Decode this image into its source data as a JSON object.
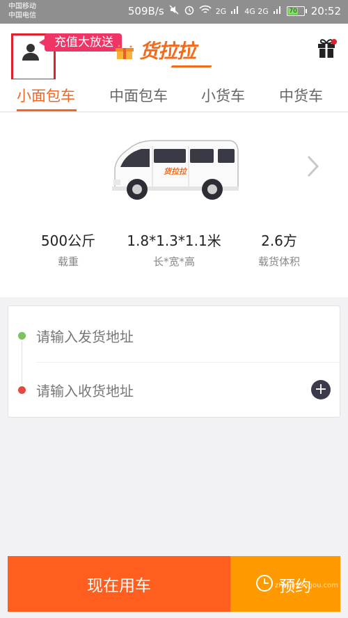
{
  "status_bar": {
    "carrier1": "中国移动",
    "carrier2": "中国电信",
    "net_speed": "509B/s",
    "net1": "2G",
    "net2": "4G 2G",
    "battery": "70",
    "time": "20:52"
  },
  "header": {
    "promo_label": "充值大放送",
    "logo_text": "货拉拉"
  },
  "tabs": [
    {
      "label": "小面包车",
      "active": true
    },
    {
      "label": "中面包车",
      "active": false
    },
    {
      "label": "小货车",
      "active": false
    },
    {
      "label": "中货车",
      "active": false
    }
  ],
  "vehicle": {
    "brand_on_van": "货拉拉",
    "specs": [
      {
        "value": "500公斤",
        "label": "载重"
      },
      {
        "value": "1.8*1.3*1.1米",
        "label": "长*宽*高"
      },
      {
        "value": "2.6方",
        "label": "载货体积"
      }
    ]
  },
  "address": {
    "from_placeholder": "请输入发货地址",
    "to_placeholder": "请输入收货地址",
    "add_label": "+"
  },
  "actions": {
    "now_label": "现在用车",
    "book_label": "预约"
  },
  "watermark": "zhinan.sogou.com",
  "colors": {
    "accent": "#f26522",
    "now_button": "#ff5e1f",
    "book_button": "#ff9900",
    "promo": "#ef3466",
    "highlight_box": "#e0202a"
  }
}
